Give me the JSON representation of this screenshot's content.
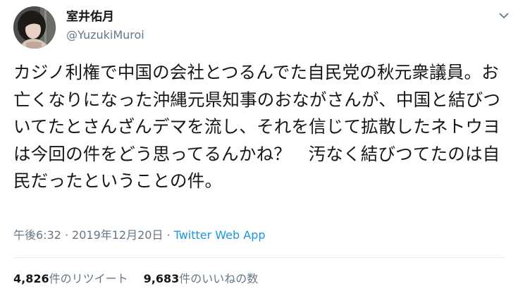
{
  "user": {
    "display_name": "室井佑月",
    "screen_name": "@YuzukiMuroi",
    "avatar_icon": "avatar-photo"
  },
  "menu": {
    "icon": "chevron-down-icon"
  },
  "tweet": {
    "text": "カジノ利権で中国の会社とつるんでた自民党の秋元衆議員。お亡くなりになった沖縄元県知事のおながさんが、中国と結びついてたとさんざんデマを流し、それを信じて拡散したネトウヨは今回の件をどう思ってるんかね？　汚なく結びつてたのは自民だったということの件。",
    "time": "午後6:32",
    "separator": "·",
    "date": "2019年12月20日",
    "source": "Twitter Web App"
  },
  "stats": {
    "retweets_count": "4,826",
    "retweets_label": "件のリツイート",
    "likes_count": "9,683",
    "likes_label": "件のいいねの数"
  },
  "colors": {
    "text": "#14171a",
    "secondary": "#657786",
    "link": "#1b95e0",
    "divider": "#e6ecf0"
  }
}
